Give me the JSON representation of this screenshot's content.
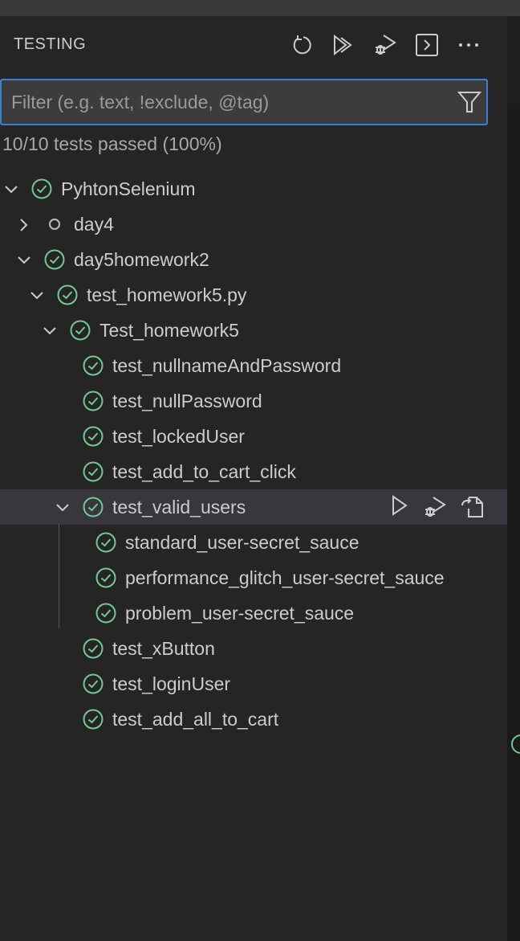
{
  "header": {
    "title": "TESTING",
    "actions": [
      {
        "icon": "refresh-icon"
      },
      {
        "icon": "run-all-icon"
      },
      {
        "icon": "debug-all-icon"
      },
      {
        "icon": "terminal-icon"
      },
      {
        "icon": "more-icon"
      }
    ]
  },
  "filter": {
    "placeholder": "Filter (e.g. text, !exclude, @tag)",
    "value": ""
  },
  "summary": "10/10 tests passed (100%)",
  "colors": {
    "passed": "#73c991",
    "accent": "#3b7fd4",
    "selected": "#37373d"
  },
  "tree": [
    {
      "label": "PyhtonSelenium",
      "level": 0,
      "chevron": "down",
      "status": "passed"
    },
    {
      "label": "day4",
      "level": 1,
      "chevron": "right",
      "status": "unset"
    },
    {
      "label": "day5homework2",
      "level": 1,
      "chevron": "down",
      "status": "passed"
    },
    {
      "label": "test_homework5.py",
      "level": 2,
      "chevron": "down",
      "status": "passed"
    },
    {
      "label": "Test_homework5",
      "level": 3,
      "chevron": "down",
      "status": "passed"
    },
    {
      "label": "test_nullnameAndPassword",
      "level": 4,
      "chevron": "none",
      "status": "passed"
    },
    {
      "label": "test_nullPassword",
      "level": 4,
      "chevron": "none",
      "status": "passed"
    },
    {
      "label": "test_lockedUser",
      "level": 4,
      "chevron": "none",
      "status": "passed"
    },
    {
      "label": "test_add_to_cart_click",
      "level": 4,
      "chevron": "none",
      "status": "passed"
    },
    {
      "label": "test_valid_users",
      "level": 4,
      "chevron": "down",
      "status": "passed",
      "selected": true,
      "actions": [
        "run-icon",
        "debug-icon",
        "go-to-file-icon"
      ]
    },
    {
      "label": "standard_user-secret_sauce",
      "level": 5,
      "chevron": "none",
      "status": "passed"
    },
    {
      "label": "performance_glitch_user-secret_sauce",
      "level": 5,
      "chevron": "none",
      "status": "passed"
    },
    {
      "label": "problem_user-secret_sauce",
      "level": 5,
      "chevron": "none",
      "status": "passed"
    },
    {
      "label": "test_xButton",
      "level": 4,
      "chevron": "none",
      "status": "passed"
    },
    {
      "label": "test_loginUser",
      "level": 4,
      "chevron": "none",
      "status": "passed"
    },
    {
      "label": "test_add_all_to_cart",
      "level": 4,
      "chevron": "none",
      "status": "passed"
    }
  ]
}
